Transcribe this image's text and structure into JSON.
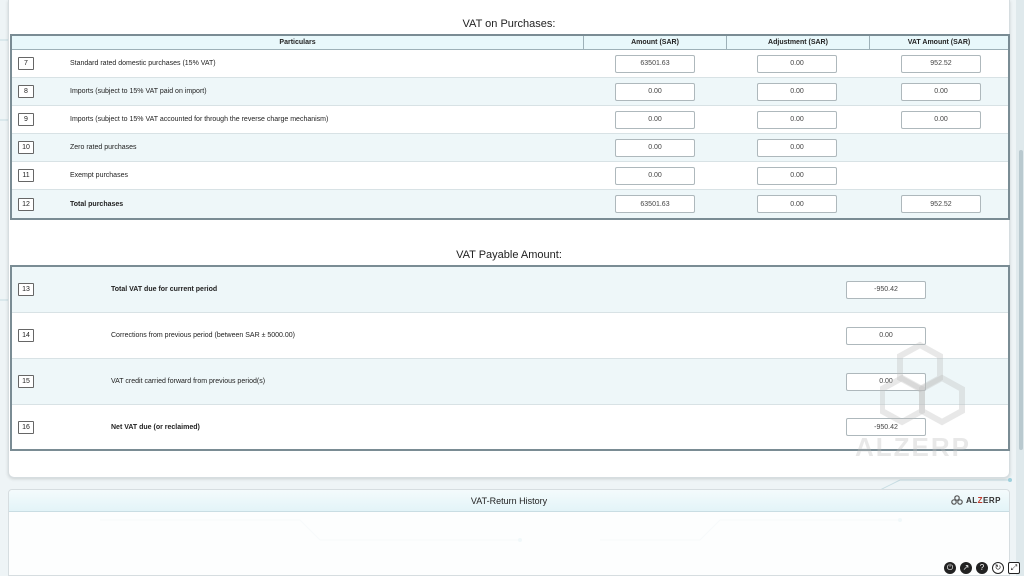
{
  "purchases": {
    "title": "VAT on Purchases:",
    "headers": {
      "particulars": "Particulars",
      "amount": "Amount (SAR)",
      "adjustment": "Adjustment (SAR)",
      "vat": "VAT Amount (SAR)"
    },
    "rows": [
      {
        "num": "7",
        "label": "Standard rated domestic purchases (15% VAT)",
        "amount": "63501.63",
        "adjustment": "0.00",
        "vat": "952.52"
      },
      {
        "num": "8",
        "label": "Imports (subject to 15% VAT paid on import)",
        "amount": "0.00",
        "adjustment": "0.00",
        "vat": "0.00"
      },
      {
        "num": "9",
        "label": "Imports (subject to 15% VAT accounted for through the reverse charge mechanism)",
        "amount": "0.00",
        "adjustment": "0.00",
        "vat": "0.00"
      },
      {
        "num": "10",
        "label": "Zero rated purchases",
        "amount": "0.00",
        "adjustment": "0.00"
      },
      {
        "num": "11",
        "label": "Exempt purchases",
        "amount": "0.00",
        "adjustment": "0.00"
      },
      {
        "num": "12",
        "label": "Total purchases",
        "amount": "63501.63",
        "adjustment": "0.00",
        "vat": "952.52"
      }
    ]
  },
  "payable": {
    "title": "VAT Payable Amount:",
    "rows": [
      {
        "num": "13",
        "label": "Total VAT due for current period",
        "value": "-950.42"
      },
      {
        "num": "14",
        "label": "Corrections from previous period (between SAR ± 5000.00)",
        "value": "0.00"
      },
      {
        "num": "15",
        "label": "VAT credit carried forward from previous period(s)",
        "value": "0.00"
      },
      {
        "num": "16",
        "label": "Net VAT due (or reclaimed)",
        "value": "-950.42"
      }
    ]
  },
  "history": {
    "title": "VAT-Return History"
  },
  "logo": {
    "brand": "ALZERP",
    "prefix": "AL",
    "mid": "Z",
    "suffix": "ERP"
  },
  "watermark": {
    "text": "ALZERP"
  },
  "icons": [
    "power-icon",
    "share-icon",
    "help-icon",
    "refresh-icon",
    "fullscreen-icon"
  ],
  "colors": {
    "header_bg": "#e8f8fb",
    "alt_row": "#eef7f9",
    "brand_red": "#c0392b"
  }
}
